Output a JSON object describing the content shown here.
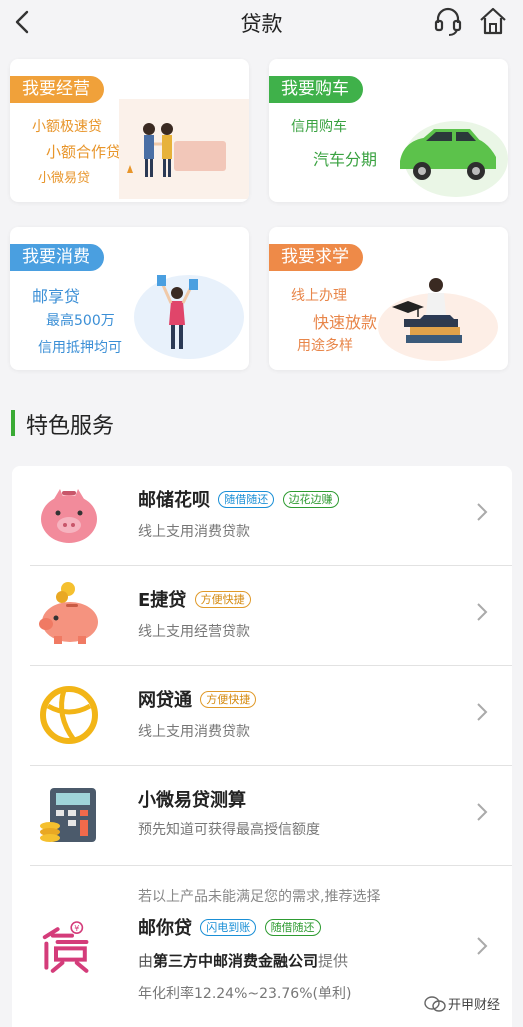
{
  "header": {
    "title": "贷款"
  },
  "cards": [
    {
      "tag": "我要经营",
      "tag_color": "#f0a13a",
      "lines": [
        "小额极速贷",
        "小额合作贷",
        "小微易贷"
      ],
      "text_color": "#e8952a"
    },
    {
      "tag": "我要购车",
      "tag_color": "#3fb14a",
      "lines": [
        "信用购车",
        "汽车分期"
      ],
      "text_color": "#3aa241"
    },
    {
      "tag": "我要消费",
      "tag_color": "#4a9fe0",
      "lines": [
        "邮享贷",
        "最高500万",
        "信用抵押均可"
      ],
      "text_color": "#3b8fd6"
    },
    {
      "tag": "我要求学",
      "tag_color": "#ee8a48",
      "lines": [
        "线上办理",
        "快速放款",
        "用途多样"
      ],
      "text_color": "#e8864a"
    }
  ],
  "section": {
    "title": "特色服务"
  },
  "services": [
    {
      "title": "邮储花呗",
      "badges": [
        {
          "text": "随借随还",
          "style": "blue"
        },
        {
          "text": "边花边赚",
          "style": "green"
        }
      ],
      "subtitle": "线上支用消费贷款",
      "icon": "piggy-pink-icon"
    },
    {
      "title": "E捷贷",
      "badges": [
        {
          "text": "方便快捷",
          "style": "orange"
        }
      ],
      "subtitle": "线上支用经营贷款",
      "icon": "piggy-coin-icon"
    },
    {
      "title": "网贷通",
      "badges": [
        {
          "text": "方便快捷",
          "style": "orange"
        }
      ],
      "subtitle": "线上支用消费贷款",
      "icon": "globe-icon"
    },
    {
      "title": "小微易贷测算",
      "badges": [],
      "subtitle": "预先知道可获得最高授信额度",
      "icon": "calculator-icon"
    }
  ],
  "recommend": {
    "intro": "若以上产品未能满足您的需求,推荐选择",
    "title": "邮你贷",
    "badges": [
      {
        "text": "闪电到账",
        "style": "blue"
      },
      {
        "text": "随借随还",
        "style": "green"
      }
    ],
    "provider_prefix": "由",
    "provider": "第三方中邮消费金融公司",
    "provider_suffix": "提供",
    "rate": "年化利率12.24%~23.76%(单利)",
    "icon": "dai-icon"
  },
  "watermark": {
    "text": "开甲财经"
  }
}
